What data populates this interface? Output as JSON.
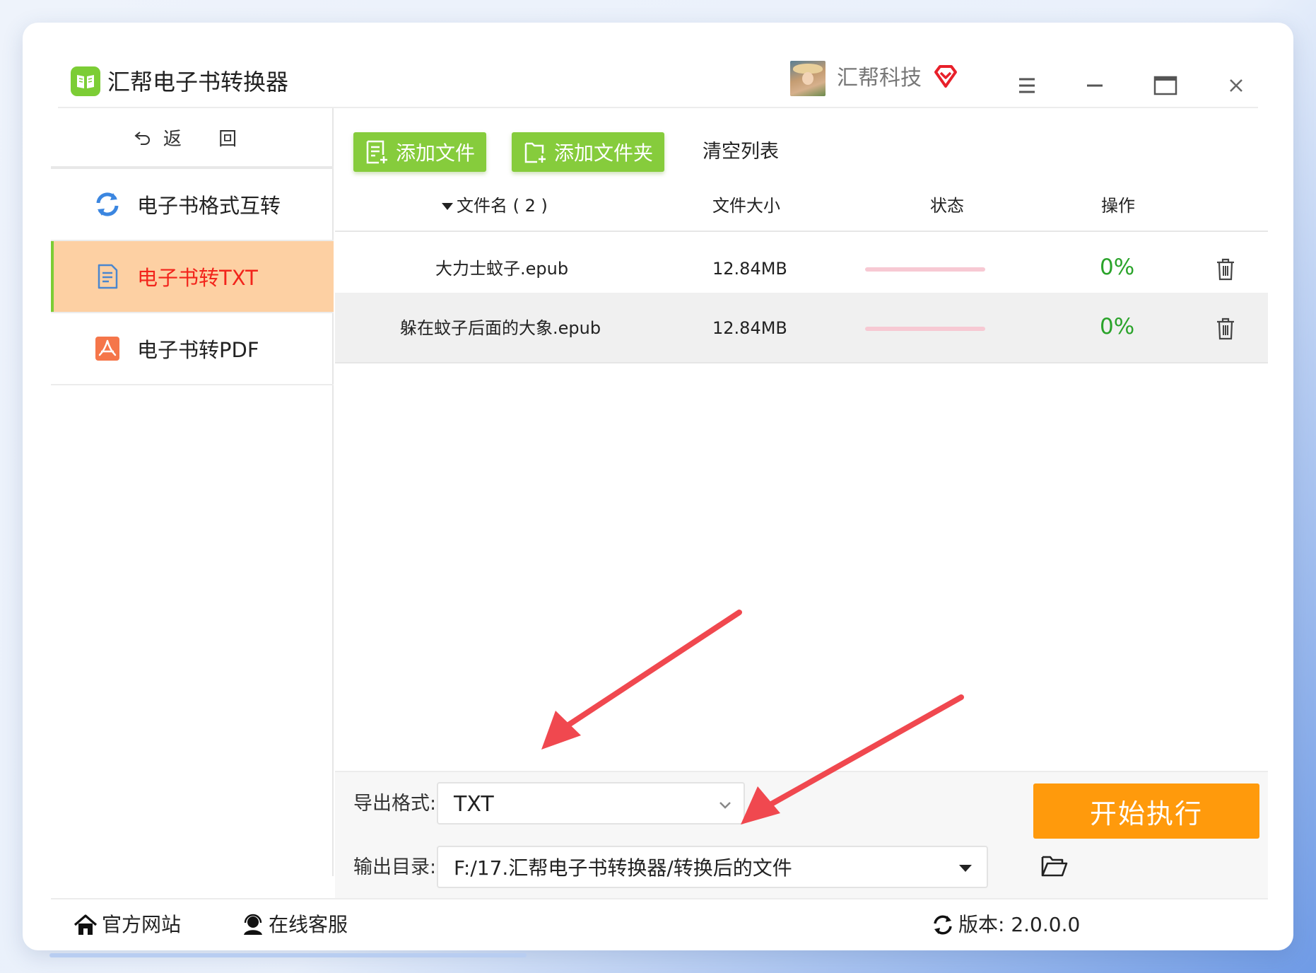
{
  "app": {
    "title": "汇帮电子书转换器"
  },
  "user": {
    "name": "汇帮科技"
  },
  "sidebar": {
    "back_label": "返 回",
    "items": [
      {
        "label": "电子书格式互转",
        "icon": "refresh-icon",
        "active": false
      },
      {
        "label": "电子书转TXT",
        "icon": "document-icon",
        "active": true
      },
      {
        "label": "电子书转PDF",
        "icon": "pdf-icon",
        "active": false
      }
    ]
  },
  "toolbar": {
    "add_file": "添加文件",
    "add_folder": "添加文件夹",
    "clear_list": "清空列表"
  },
  "table": {
    "headers": {
      "name": "文件名 ( 2 )",
      "size": "文件大小",
      "status": "状态",
      "action": "操作"
    },
    "rows": [
      {
        "name": "大力士蚊子.epub",
        "size": "12.84MB",
        "progress": 0,
        "progress_label": "0%"
      },
      {
        "name": "躲在蚊子后面的大象.epub",
        "size": "12.84MB",
        "progress": 0,
        "progress_label": "0%"
      }
    ]
  },
  "config": {
    "format_label": "导出格式:",
    "format_value": "TXT",
    "output_label": "输出目录:",
    "output_value": "F:/17.汇帮电子书转换器/转换后的文件"
  },
  "start_button": "开始执行",
  "footer": {
    "website": "官方网站",
    "support": "在线客服",
    "version": "版本: 2.0.0.0"
  },
  "colors": {
    "accent_green": "#86cc3c",
    "active_bg": "#fdd0a3",
    "active_text": "#f2241b",
    "start_orange": "#ff9a0c",
    "progress_text": "#2aa32a",
    "arrow_red": "#f0484f"
  }
}
